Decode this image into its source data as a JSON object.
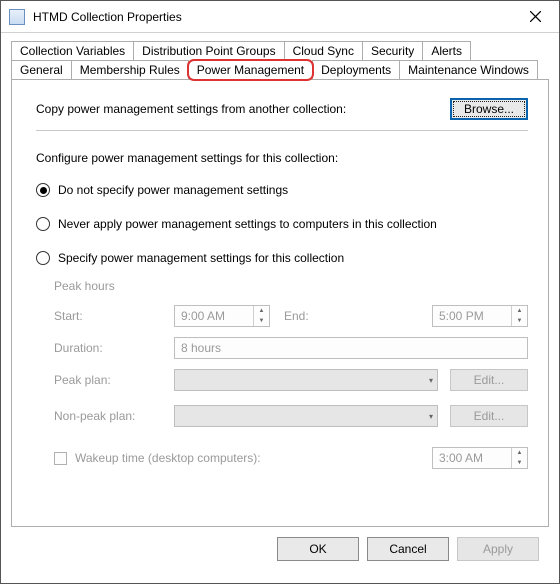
{
  "title": "HTMD Collection Properties",
  "tabs_row1": [
    "Collection Variables",
    "Distribution Point Groups",
    "Cloud Sync",
    "Security",
    "Alerts"
  ],
  "tabs_row2": [
    "General",
    "Membership Rules",
    "Power Management",
    "Deployments",
    "Maintenance Windows"
  ],
  "active_tab": "Power Management",
  "copy_label": "Copy power management settings from another collection:",
  "browse_label": "Browse...",
  "configure_label": "Configure power management settings for this collection:",
  "radios": [
    "Do not specify power management settings",
    "Never apply power management settings to computers in this collection",
    "Specify power management settings for this collection"
  ],
  "selected_radio": 0,
  "peak": {
    "header": "Peak hours",
    "start_label": "Start:",
    "start_value": "9:00 AM",
    "end_label": "End:",
    "end_value": "5:00 PM",
    "duration_label": "Duration:",
    "duration_value": "8 hours",
    "peak_plan_label": "Peak plan:",
    "peak_plan_value": "",
    "edit_label": "Edit...",
    "nonpeak_plan_label": "Non-peak plan:",
    "nonpeak_plan_value": "",
    "wakeup_label": "Wakeup time (desktop computers):",
    "wakeup_value": "3:00 AM"
  },
  "footer": {
    "ok": "OK",
    "cancel": "Cancel",
    "apply": "Apply"
  }
}
